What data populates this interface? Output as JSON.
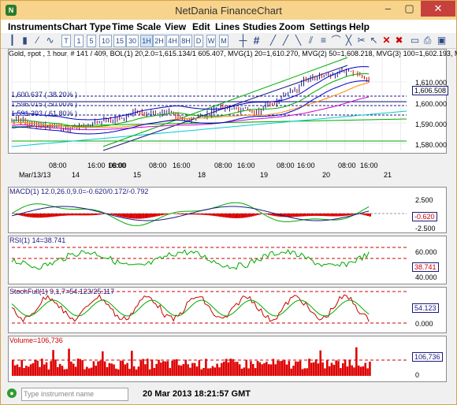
{
  "window": {
    "title": "NetDania FinanceChart",
    "controls": [
      "–",
      "▢",
      "✕"
    ]
  },
  "menu": [
    "Instruments",
    "Chart Type",
    "Time Scale",
    "View",
    "Edit",
    "Lines",
    "Studies",
    "Zoom",
    "Settings",
    "Help"
  ],
  "toolbar": {
    "timescales": [
      "T",
      "1",
      "5",
      "10",
      "15",
      "30",
      "1H",
      "2H",
      "4H",
      "8H",
      "D",
      "W",
      "M"
    ],
    "active_timescale": "1H",
    "icons": [
      "bar-chart-icon",
      "candle-chart-icon",
      "line-chart-icon",
      "crosshair-icon",
      "hash-grid-icon",
      "trend-lines-icon",
      "delete-icon",
      "tools-icon",
      "print-icon",
      "window-icon"
    ]
  },
  "main": {
    "header": "Gold, spot , 1 hour, # 141 / 409, BOL(1) 20,2.0=1,615.134/1,605.407, MVG(1) 20=1,610.270, MVG(2) 50=1,608.218, MVG(3) 100=1,602.193, MV",
    "fib_labels": [
      "1,600.637 ( 38.20% )",
      "1,596.015 ( 50.00% )",
      "1,591.393 ( 61.80% )"
    ],
    "y_ticks": [
      "1,610.000",
      "1,600.000",
      "1,590.000",
      "1,580.000"
    ],
    "last_price": "1,606.508",
    "x_ticks": [
      "Mar/13/13",
      "08:00",
      "16:00",
      "14",
      "08:00",
      "16:00",
      "15",
      "08:00",
      "16:00",
      "18",
      "08:00",
      "16:00",
      "19",
      "08:00",
      "16:00",
      "20",
      "08:00",
      "16:00",
      "21"
    ],
    "x_date_row": [
      "Mar/13/13",
      "14",
      "15",
      "18",
      "19",
      "20",
      "21"
    ]
  },
  "macd": {
    "label": "MACD(1) 12.0,26.0,9.0=-0.620/0.172/-0.792",
    "y_ticks": [
      "2.500",
      "0.000",
      "-2.500"
    ],
    "value": "-0.620"
  },
  "rsi": {
    "label": "RSI(1) 14=38.741",
    "y_ticks": [
      "60.000",
      "40.000"
    ],
    "value": "38.741"
  },
  "stoch": {
    "label": "StochFull(1) 9,1,7=54.123/25.117",
    "y_ticks": [
      "0.000"
    ],
    "value": "54.123"
  },
  "volume": {
    "label": "Volume=106,736",
    "y_ticks": [
      "0"
    ],
    "value": "106,736"
  },
  "status": {
    "placeholder": "Type instrument name",
    "datetime": "20 Mar 2013 18:21:57 GMT"
  },
  "colors": {
    "titlebar": "#f7d38c",
    "close": "#c7413c",
    "bollinger": "#0000cc",
    "price": "#cc0000",
    "mvg1": "#00aa00",
    "mvg2": "#ff8800",
    "mvg3": "#cc00cc"
  }
}
